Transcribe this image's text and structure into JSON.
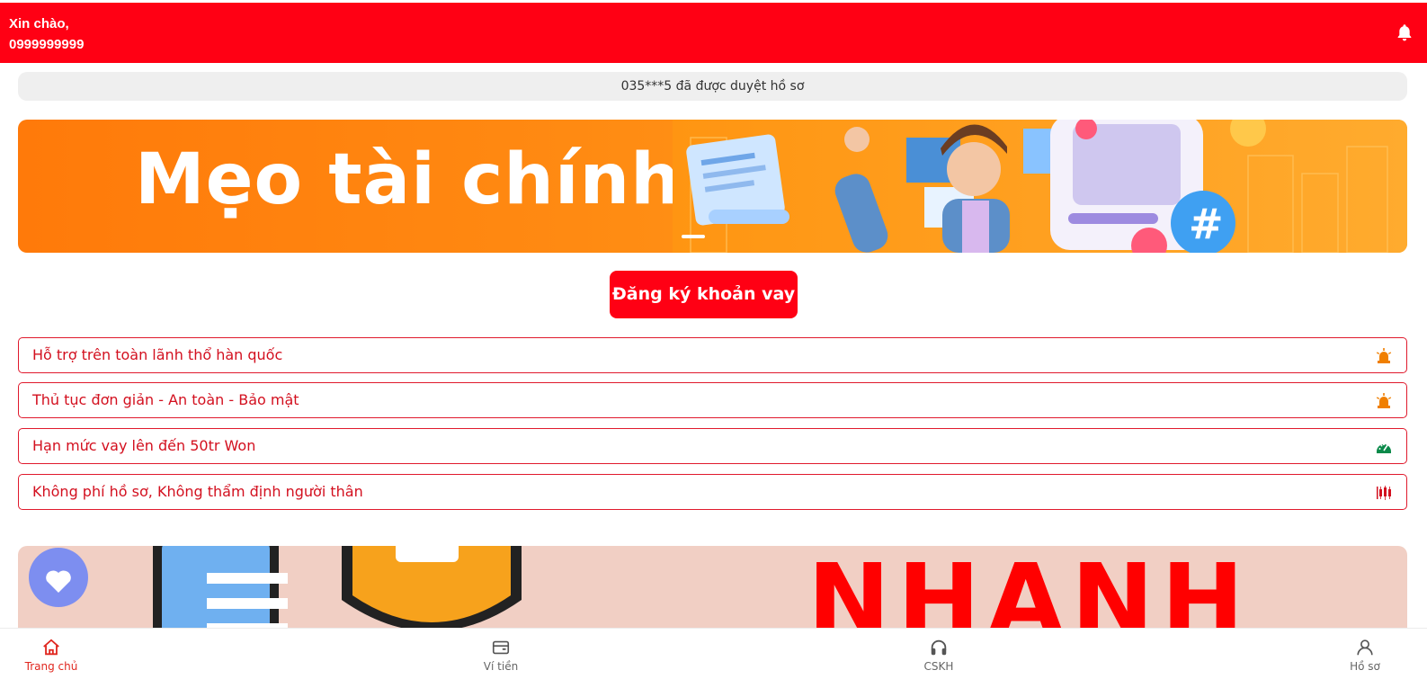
{
  "header": {
    "greeting": "Xin chào,",
    "phone": "0999999999",
    "notification_icon": "bell-icon"
  },
  "ticker": {
    "text": "035***5 đã được duyệt hồ sơ"
  },
  "banner_top": {
    "title": "Mẹo tài chính"
  },
  "register_button": {
    "label": "Đăng ký khoản vay"
  },
  "features": [
    {
      "label": "Hỗ trợ trên toàn lãnh thổ hàn quốc",
      "icon": "siren-icon",
      "icon_color": "#f07f00"
    },
    {
      "label": "Thủ tục đơn giản - An toàn - Bảo mật",
      "icon": "siren-icon",
      "icon_color": "#f07f00"
    },
    {
      "label": "Hạn mức vay lên đến 50tr Won",
      "icon": "speedometer-icon",
      "icon_color": "#0b8a4a"
    },
    {
      "label": "Không phí hồ sơ, Không thẩm định người thân",
      "icon": "candlestick-icon",
      "icon_color": "#d3101f"
    }
  ],
  "banner_bottom": {
    "text": "NHANH"
  },
  "bottom_nav": {
    "items": [
      {
        "label": "Trang chủ",
        "icon": "home-icon",
        "active": true
      },
      {
        "label": "Ví tiền",
        "icon": "wallet-icon",
        "active": false
      },
      {
        "label": "CSKH",
        "icon": "headphones-icon",
        "active": false
      },
      {
        "label": "Hồ sơ",
        "icon": "user-icon",
        "active": false
      }
    ]
  },
  "colors": {
    "brand_red": "#ff0014",
    "feature_text": "#d3101f",
    "active_nav": "#e0271f",
    "banner_orange": "#ff8a12"
  }
}
